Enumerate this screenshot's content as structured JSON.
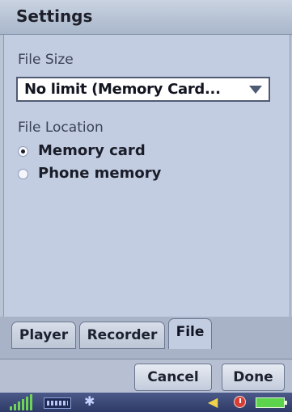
{
  "title": "Settings",
  "file_size": {
    "label": "File Size",
    "value": "No limit (Memory Card..."
  },
  "file_location": {
    "label": "File Location",
    "options": [
      {
        "label": "Memory card",
        "selected": true
      },
      {
        "label": "Phone memory",
        "selected": false
      }
    ]
  },
  "tabs": [
    {
      "label": "Player",
      "active": false
    },
    {
      "label": "Recorder",
      "active": false
    },
    {
      "label": "File",
      "active": true
    }
  ],
  "buttons": {
    "cancel": "Cancel",
    "done": "Done"
  },
  "status_bar": {
    "icons": [
      "signal-icon",
      "keyboard-icon",
      "bluetooth-icon",
      "speaker-icon",
      "clock-icon",
      "battery-icon"
    ]
  }
}
